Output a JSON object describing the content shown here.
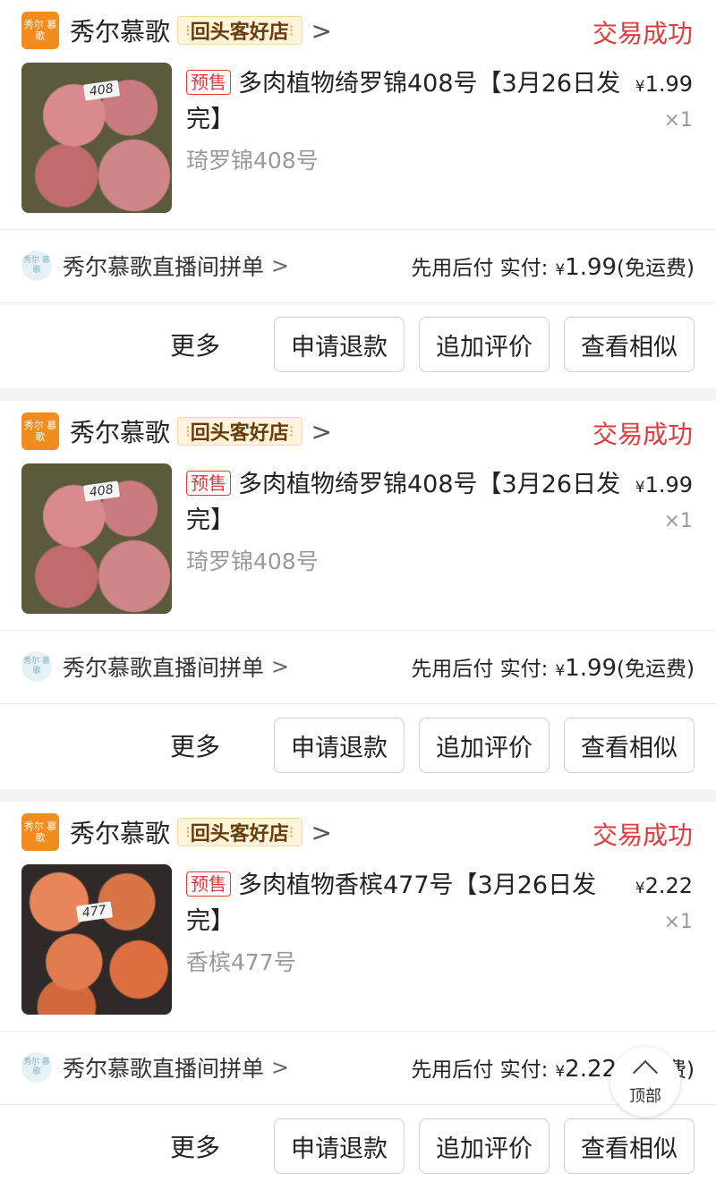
{
  "orders": [
    {
      "shop_logo_text": "秀尔 慕歌",
      "shop_name": "秀尔慕歌",
      "badge": "回头客好店",
      "status": "交易成功",
      "presale_tag": "预售",
      "product_title": "多肉植物绮罗锦408号【3月26日发完】",
      "spec": "琦罗锦408号",
      "price": "1.99",
      "currency": "¥",
      "quantity": "×1",
      "thumb_label": "408",
      "live_icon_text": "秀尔 慕歌",
      "live_room": "秀尔慕歌直播间拼单",
      "pay_method": "先用后付",
      "paid_label": "实付:",
      "paid_amount": "1.99",
      "shipping_note": "(免运费)",
      "actions": {
        "more": "更多",
        "refund": "申请退款",
        "review": "追加评价",
        "similar": "查看相似"
      }
    },
    {
      "shop_logo_text": "秀尔 慕歌",
      "shop_name": "秀尔慕歌",
      "badge": "回头客好店",
      "status": "交易成功",
      "presale_tag": "预售",
      "product_title": "多肉植物绮罗锦408号【3月26日发完】",
      "spec": "琦罗锦408号",
      "price": "1.99",
      "currency": "¥",
      "quantity": "×1",
      "thumb_label": "408",
      "live_icon_text": "秀尔 慕歌",
      "live_room": "秀尔慕歌直播间拼单",
      "pay_method": "先用后付",
      "paid_label": "实付:",
      "paid_amount": "1.99",
      "shipping_note": "(免运费)",
      "actions": {
        "more": "更多",
        "refund": "申请退款",
        "review": "追加评价",
        "similar": "查看相似"
      }
    },
    {
      "shop_logo_text": "秀尔 慕歌",
      "shop_name": "秀尔慕歌",
      "badge": "回头客好店",
      "status": "交易成功",
      "presale_tag": "预售",
      "product_title": "多肉植物香槟477号【3月26日发完】",
      "spec": "香槟477号",
      "price": "2.22",
      "currency": "¥",
      "quantity": "×1",
      "thumb_label": "477",
      "live_icon_text": "秀尔 慕歌",
      "live_room": "秀尔慕歌直播间拼单",
      "pay_method": "先用后付",
      "paid_label": "实付:",
      "paid_amount": "2.22",
      "shipping_note": "(免运费)",
      "actions": {
        "more": "更多",
        "refund": "申请退款",
        "review": "追加评价",
        "similar": "查看相似"
      }
    }
  ],
  "back_to_top": "顶部",
  "colors": {
    "status": "#e4393c",
    "logo": "#f28c1e",
    "badge_bg": "#fff3dc"
  }
}
